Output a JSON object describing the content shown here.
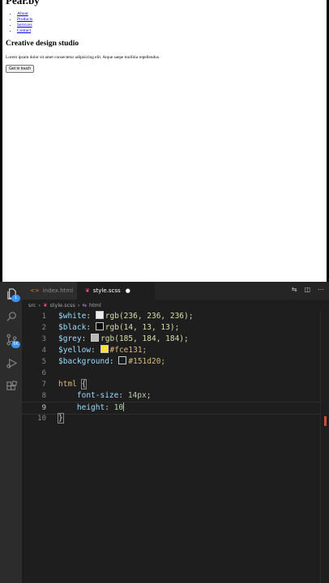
{
  "preview": {
    "logo": "Pear.by",
    "nav": [
      "About",
      "Products",
      "Services",
      "Contact"
    ],
    "title": "Creative design studio",
    "text": "Lorem ipsum dolor sit amet consectetur adipisicing elit. Atque saepe mollitia repellendus.",
    "button": "Get in touch"
  },
  "editor": {
    "tabs": [
      {
        "name": "index.html",
        "icon": "html-icon",
        "active": false
      },
      {
        "name": "style.scss",
        "icon": "scss-icon",
        "active": true,
        "modified": true
      }
    ],
    "breadcrumbs": [
      "src",
      "style.scss",
      "html"
    ],
    "activity_badge_scm": "1",
    "activity_badge_ext": "6K",
    "current_line": 9,
    "lines": [
      {
        "n": "1",
        "name": "$white",
        "swatch": "#ececec",
        "value": "rgb(236, 236, 236);"
      },
      {
        "n": "2",
        "name": "$black",
        "swatch": "#0e0d0d",
        "value": "rgb(14, 13, 13);"
      },
      {
        "n": "3",
        "name": "$grey",
        "swatch": "#b9b8b8",
        "value": "rgb(185, 184, 184);"
      },
      {
        "n": "4",
        "name": "$yellow",
        "swatch": "#fce131",
        "value": "#fce131;"
      },
      {
        "n": "5",
        "name": "$background",
        "swatch": "#151d20",
        "value": "#151d20;"
      },
      {
        "n": "6"
      },
      {
        "n": "7",
        "selector": "html",
        "brace": "{"
      },
      {
        "n": "8",
        "prop": "font-size",
        "pvalue": "14px",
        "end": ";"
      },
      {
        "n": "9",
        "prop": "height",
        "pvalue": "10",
        "end": ""
      },
      {
        "n": "10",
        "brace": "}"
      }
    ]
  },
  "colors": {
    "accent": "#3794ff",
    "editor_bg": "#1e1e1e",
    "scss_icon": "#f55385"
  }
}
